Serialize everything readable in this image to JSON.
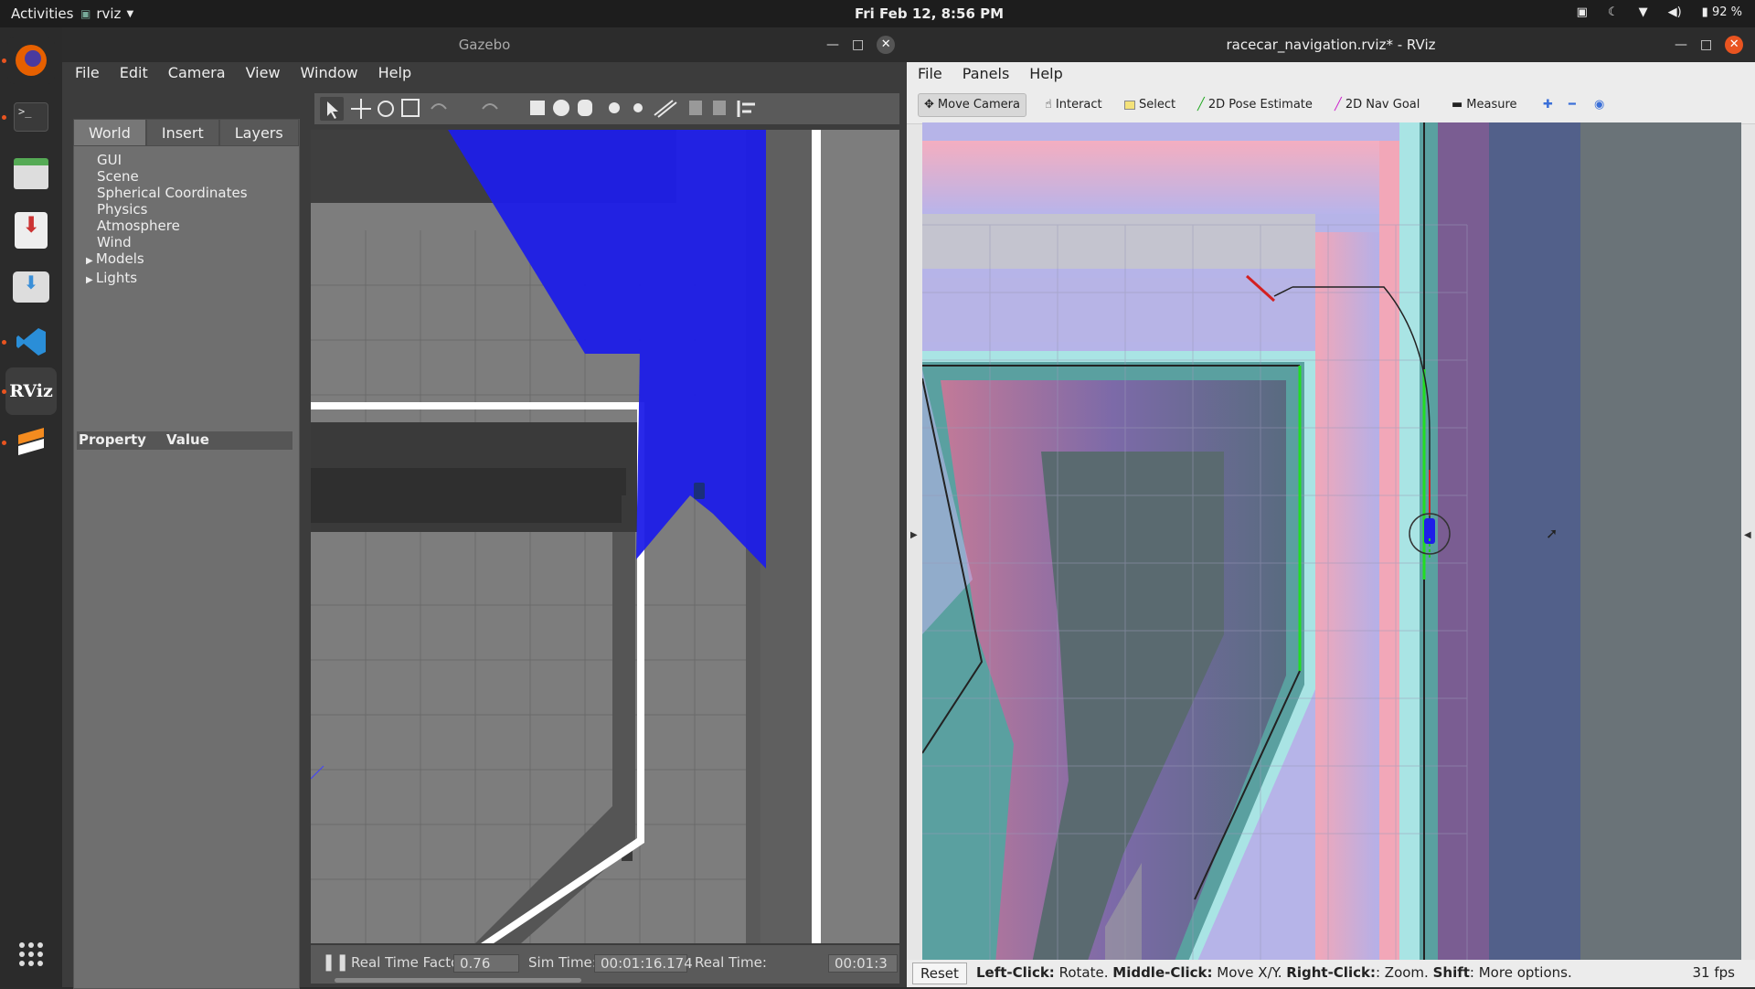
{
  "topbar": {
    "activities": "Activities",
    "app_menu": "rviz",
    "clock": "Fri Feb 12,  8:56 PM",
    "battery": "92 %"
  },
  "dock": {
    "items": [
      "firefox-icon",
      "terminal-icon",
      "files-icon",
      "installer-icon",
      "software-icon",
      "vscode-icon",
      "rviz-icon",
      "sublime-icon",
      "apps-grid-icon"
    ],
    "rviz_label": "RViz"
  },
  "gazebo": {
    "title": "Gazebo",
    "menu": [
      "File",
      "Edit",
      "Camera",
      "View",
      "Window",
      "Help"
    ],
    "tabs": [
      "World",
      "Insert",
      "Layers"
    ],
    "tree": [
      "GUI",
      "Scene",
      "Spherical Coordinates",
      "Physics",
      "Atmosphere",
      "Wind",
      "Models",
      "Lights"
    ],
    "property_header": "Property",
    "value_header": "Value",
    "status": {
      "rtf_label": "Real Time Factor:",
      "rtf_value": "0.76",
      "sim_label": "Sim Time:",
      "sim_value": "00:01:16.174",
      "real_label": "Real Time:",
      "real_value": "00:01:3"
    }
  },
  "rviz": {
    "title": "racecar_navigation.rviz* - RViz",
    "menu": [
      "File",
      "Panels",
      "Help"
    ],
    "tools": [
      "Move Camera",
      "Interact",
      "Select",
      "2D Pose Estimate",
      "2D Nav Goal",
      "Measure"
    ],
    "status": {
      "reset": "Reset",
      "left_click": "Left-Click:",
      "left_text": "Rotate.",
      "middle_click": "Middle-Click:",
      "middle_text": "Move X/Y.",
      "right_click": "Right-Click:",
      "right_text": ": Zoom.",
      "shift": "Shift",
      "shift_text": ": More options.",
      "fps": "31 fps"
    }
  },
  "colors": {
    "accent": "#e95420",
    "laser": "#1e1ee8",
    "costmap_inflation": "#f2a7b8",
    "costmap_lethal": "#5aa0a0",
    "costmap_free": "#b6b6e8"
  }
}
